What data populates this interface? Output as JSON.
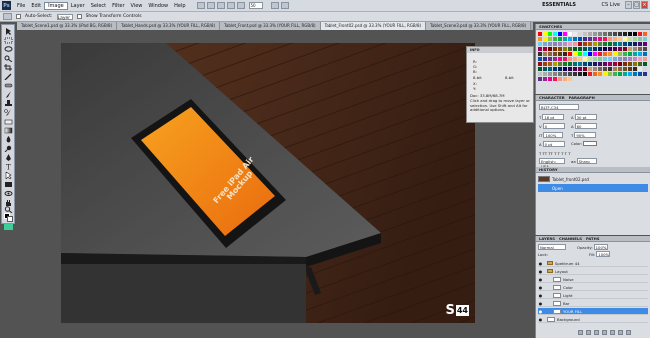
{
  "menubar": {
    "logo": "Ps",
    "items": [
      "File",
      "Edit",
      "Image",
      "Layer",
      "Select",
      "Filter",
      "View",
      "Window",
      "Help"
    ],
    "active_index": 2,
    "zoom": "50",
    "workspace": "ESSENTIALS",
    "cslive": "CS Live"
  },
  "options": {
    "auto_select": "Auto-Select:",
    "layer_select": "Layer",
    "show_transform": "Show Transform Controls"
  },
  "tabs": [
    "Tablet_Scene1.psd @ 33.3% (iPad BG, RGB/8)",
    "Tablet_Hands.psd @ 33.3% (YOUR FILL, RGB/8)",
    "Tablet_Front.psd @ 33.3% (YOUR FILL, RGB/8)",
    "Tablet_Front02.psd @ 33.3% (YOUR FILL, RGB/8)",
    "Tablet_Scene3.psd @ 33.3% (YOUR FILL, RGB/8)"
  ],
  "canvas": {
    "ipad_text": "Free iPad Air Mockup",
    "badge_s": "S",
    "badge_n": "44"
  },
  "info_panel": {
    "title": "INFO",
    "r": "R:",
    "g": "G:",
    "b": "B:",
    "x": "X:",
    "y": "Y:",
    "bit": "8-bit",
    "doc": "Doc: 33.8M/68.7M",
    "help": "Click and drag to move layer or selection. Use Shift and Alt for additional options."
  },
  "swatches": {
    "title": "SWATCHES",
    "colors": [
      "#ff0000",
      "#ffff00",
      "#00ff00",
      "#00ffff",
      "#0000ff",
      "#ff00ff",
      "#ffffff",
      "#ebebeb",
      "#d6d6d6",
      "#c2c2c2",
      "#adadad",
      "#999999",
      "#858585",
      "#707070",
      "#5c5c5c",
      "#474747",
      "#333333",
      "#1f1f1f",
      "#0a0a0a",
      "#000000",
      "#ed1c24",
      "#f26522",
      "#f7941d",
      "#fff200",
      "#8dc63f",
      "#39b54a",
      "#00a651",
      "#00a99d",
      "#00aeef",
      "#0072bc",
      "#0054a6",
      "#2e3192",
      "#662d91",
      "#92278f",
      "#ec008c",
      "#ed145b",
      "#f69679",
      "#f9ad81",
      "#fdc68a",
      "#fff799",
      "#c4df9b",
      "#a3d39c",
      "#82ca9d",
      "#7accc8",
      "#6dcff6",
      "#7da7d9",
      "#8393ca",
      "#8781bd",
      "#a186be",
      "#bd8cbf",
      "#f49ac1",
      "#f5989d",
      "#9e0b0f",
      "#a0410d",
      "#a36209",
      "#aba000",
      "#598527",
      "#1a7b30",
      "#007236",
      "#00746b",
      "#0076a3",
      "#004b80",
      "#003471",
      "#1b1464",
      "#440e62",
      "#630460",
      "#9e005d",
      "#9e0039",
      "#790000",
      "#7b2e00",
      "#7d4900",
      "#827b00",
      "#406618",
      "#005e20",
      "#005826",
      "#005952",
      "#005b7f",
      "#003663",
      "#002157",
      "#0d004c",
      "#32004b",
      "#4b0049",
      "#7b0046",
      "#7a0026",
      "#c69c6d",
      "#998675",
      "#736357",
      "#534741",
      "#362f2d",
      "#a67c52",
      "#8c6239",
      "#754c24",
      "#603913",
      "#3c2415",
      "#ff0000",
      "#ffff00",
      "#00ff00",
      "#00ffff",
      "#0000ff",
      "#ff00ff",
      "#ed1c24",
      "#f26522",
      "#f7941d",
      "#fff200",
      "#8dc63f",
      "#39b54a",
      "#00a651",
      "#00a99d",
      "#00aeef",
      "#0072bc",
      "#0054a6",
      "#2e3192",
      "#662d91",
      "#92278f",
      "#ec008c",
      "#ed145b",
      "#f69679",
      "#f9ad81",
      "#fdc68a",
      "#fff799",
      "#c4df9b",
      "#a3d39c",
      "#82ca9d",
      "#7accc8",
      "#6dcff6",
      "#7da7d9",
      "#8393ca",
      "#8781bd",
      "#a186be",
      "#bd8cbf",
      "#f49ac1",
      "#f5989d",
      "#9e0b0f",
      "#a0410d",
      "#a36209",
      "#aba000",
      "#598527",
      "#1a7b30",
      "#007236",
      "#00746b",
      "#0076a3",
      "#004b80",
      "#003471",
      "#1b1464",
      "#440e62",
      "#630460",
      "#9e005d",
      "#9e0039",
      "#790000",
      "#7b2e00",
      "#7d4900",
      "#827b00",
      "#406618",
      "#005e20",
      "#005826",
      "#005952",
      "#005b7f",
      "#003663",
      "#002157",
      "#0d004c",
      "#32004b",
      "#4b0049",
      "#7b0046",
      "#7a0026",
      "#c69c6d",
      "#998675",
      "#736357",
      "#534741",
      "#362f2d",
      "#a67c52",
      "#8c6239",
      "#754c24",
      "#603913",
      "#3c2415",
      "#ebebeb",
      "#d6d6d6",
      "#c2c2c2",
      "#adadad",
      "#999999",
      "#858585",
      "#707070",
      "#5c5c5c",
      "#474747",
      "#333333",
      "#1f1f1f",
      "#0a0a0a",
      "#ed1c24",
      "#f26522",
      "#f7941d",
      "#fff200",
      "#8dc63f",
      "#39b54a",
      "#00a651",
      "#00a99d",
      "#00aeef",
      "#0072bc",
      "#0054a6",
      "#2e3192",
      "#662d91",
      "#92278f",
      "#ec008c",
      "#ed145b",
      "#f69679",
      "#f9ad81",
      "#fdc68a"
    ]
  },
  "character": {
    "tab1": "CHARACTER",
    "tab2": "PARAGRAPH",
    "font": "BLTF-C34",
    "size": "18 pt",
    "leading": "30 pt",
    "kerning": "0",
    "tracking": "60",
    "vscale": "100%",
    "hscale": "90%",
    "baseline": "0 pt",
    "color_label": "Color:",
    "language": "English: USA",
    "aa": "Sharp"
  },
  "history": {
    "title": "HISTORY",
    "doc_name": "Tablet_front02.psd",
    "step": "Open"
  },
  "layers": {
    "tabs": "LAYERS",
    "tab2": "CHANNELS",
    "tab3": "PATHS",
    "blend": "Normal",
    "opacity_label": "Opacity:",
    "opacity": "100%",
    "lock_label": "Lock:",
    "fill_label": "Fill:",
    "fill": "100%",
    "items": [
      {
        "name": "Spektrum 44",
        "type": "folder",
        "indent": 0,
        "sel": false
      },
      {
        "name": "Layout",
        "type": "folder",
        "indent": 0,
        "sel": false
      },
      {
        "name": "Noise",
        "type": "layer",
        "indent": 1,
        "sel": false
      },
      {
        "name": "Color",
        "type": "layer",
        "indent": 1,
        "sel": false
      },
      {
        "name": "Light",
        "type": "layer",
        "indent": 1,
        "sel": false
      },
      {
        "name": "Bar",
        "type": "layer",
        "indent": 1,
        "sel": false
      },
      {
        "name": "YOUR FILL",
        "type": "layer",
        "indent": 1,
        "sel": true
      },
      {
        "name": "Background",
        "type": "layer",
        "indent": 0,
        "sel": false
      }
    ]
  }
}
